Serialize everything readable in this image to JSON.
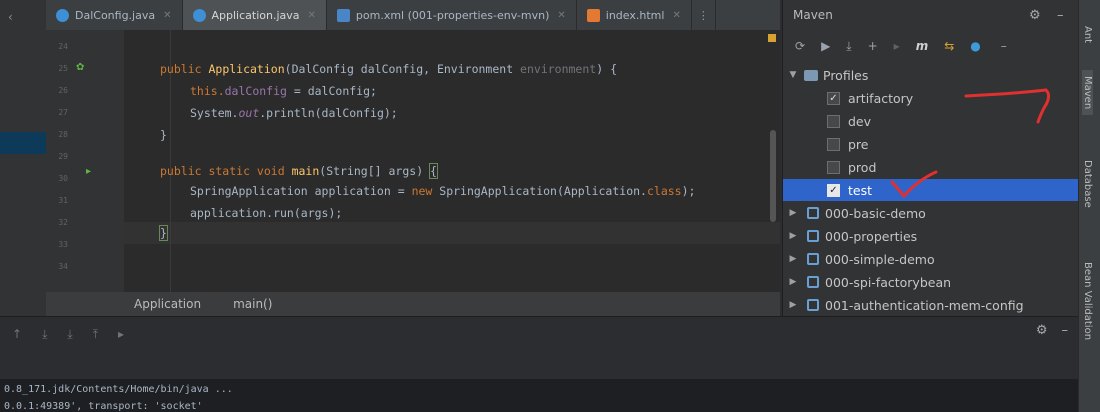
{
  "tabs": [
    {
      "label": "DalConfig.java",
      "icon": "java-class-icon",
      "color": "#3d8fd6",
      "active": false
    },
    {
      "label": "Application.java",
      "icon": "java-class-icon",
      "color": "#3d8fd6",
      "active": true
    },
    {
      "label": "pom.xml (001-properties-env-mvn)",
      "icon": "maven-m-icon",
      "color": "#4a86c7",
      "active": false
    },
    {
      "label": "index.html",
      "icon": "html-file-icon",
      "color": "#e37933",
      "active": false
    }
  ],
  "tabs_more": "⋮",
  "line_numbers": [
    "24",
    "25",
    "26",
    "27",
    "28",
    "29",
    "30",
    "31",
    "32",
    "33",
    "34"
  ],
  "code": {
    "l1_kw": "public ",
    "l1_fn": "Application",
    "l1_rest": "(DalConfig dalConfig, Environment ",
    "l1_param": "environment",
    "l1_end": ") {",
    "l2_this": "this.",
    "l2_field": "dalConfig",
    "l2_rest": " = dalConfig;",
    "l3_sys": "System.",
    "l3_out": "out",
    "l3_rest": ".println(dalConfig);",
    "l4": "}",
    "l6_kw": "public static void ",
    "l6_fn": "main",
    "l6_rest": "(String[] args) ",
    "l6_brace": "{",
    "l7_a": "SpringApplication application = ",
    "l7_new": "new ",
    "l7_b": "SpringApplication(Application.",
    "l7_cls": "class",
    "l7_c": ");",
    "l8": "application.run(args);",
    "l9": "}"
  },
  "breadcrumb": {
    "class": "Application",
    "method": "main()"
  },
  "run_output": {
    "line1": "0.8_171.jdk/Contents/Home/bin/java ...",
    "line2": "0.0.1:49389', transport: 'socket'"
  },
  "maven": {
    "title": "Maven",
    "profiles_label": "Profiles",
    "profiles": [
      {
        "label": "artifactory",
        "checked": true,
        "selected": false
      },
      {
        "label": "dev",
        "checked": false,
        "selected": false
      },
      {
        "label": "pre",
        "checked": false,
        "selected": false
      },
      {
        "label": "prod",
        "checked": false,
        "selected": false
      },
      {
        "label": "test",
        "checked": true,
        "selected": true
      }
    ],
    "modules": [
      "000-basic-demo",
      "000-properties",
      "000-simple-demo",
      "000-spi-factorybean",
      "001-authentication-mem-config"
    ]
  },
  "right_strip": {
    "ant": "Ant",
    "maven": "Maven",
    "database": "Database",
    "bean": "Bean Validation"
  },
  "colors": {
    "selection": "#2f65ca",
    "annotation": "#e0302f",
    "keyword": "#cc7832",
    "function": "#ffc66d",
    "field": "#9876aa"
  }
}
